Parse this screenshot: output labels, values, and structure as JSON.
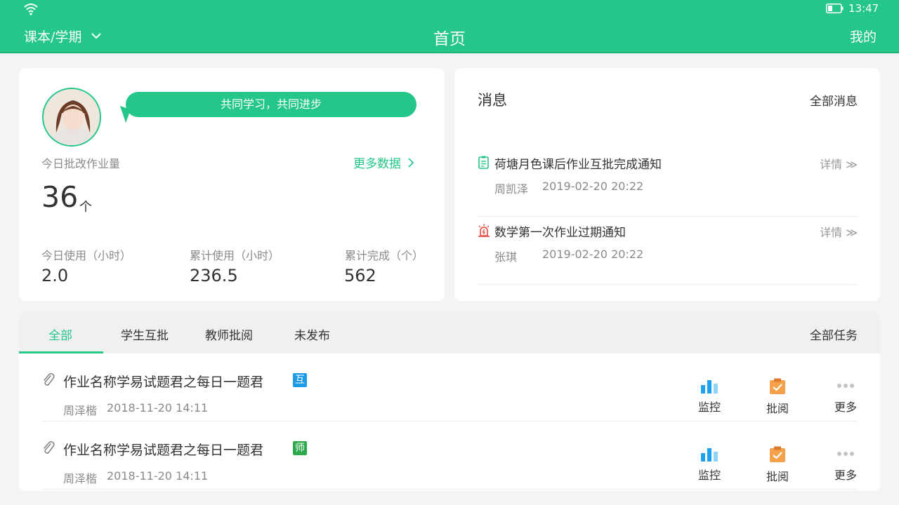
{
  "status_bar": {
    "time": "13:47"
  },
  "header": {
    "course_label": "课本/学期",
    "title": "首页",
    "mine_label": "我的"
  },
  "stats": {
    "slogan": "共同学习，共同进步",
    "today_grading_label": "今日批改作业量",
    "more_data_label": "更多数据",
    "today_grading_value": "36",
    "today_grading_unit": "个",
    "items": [
      {
        "label": "今日使用（小时）",
        "value": "2.0"
      },
      {
        "label": "累计使用（小时）",
        "value": "236.5"
      },
      {
        "label": "累计完成（个）",
        "value": "562"
      }
    ]
  },
  "messages": {
    "title": "消息",
    "all_label": "全部消息",
    "items": [
      {
        "icon": "document-icon",
        "title": "荷塘月色课后作业互批完成通知",
        "detail": "详情 ≫",
        "name": "周凯泽",
        "time": "2019-02-20  20:22"
      },
      {
        "icon": "alarm-icon",
        "title": "数学第一次作业过期通知",
        "detail": "详情 ≫",
        "name": "张琪",
        "time": "2019-02-20  20:22"
      }
    ]
  },
  "tasks": {
    "tabs": [
      "全部",
      "学生互批",
      "教师批阅",
      "未发布"
    ],
    "active_tab": 0,
    "all_label": "全部任务",
    "items": [
      {
        "title": "作业名称学易试题君之每日一题君",
        "badge": "互",
        "badge_color": "#1e9be6",
        "name": "周泽楷",
        "time": "2018-11-20  14:11"
      },
      {
        "title": "作业名称学易试题君之每日一题君",
        "badge": "师",
        "badge_color": "#2aa84a",
        "name": "周泽楷",
        "time": "2018-11-20  14:11"
      }
    ],
    "actions": {
      "monitor": "监控",
      "review": "批阅",
      "more": "更多"
    }
  },
  "colors": {
    "primary": "#24c789",
    "monitor_blue": "#1ea1f0",
    "review_orange": "#f5a04a"
  }
}
